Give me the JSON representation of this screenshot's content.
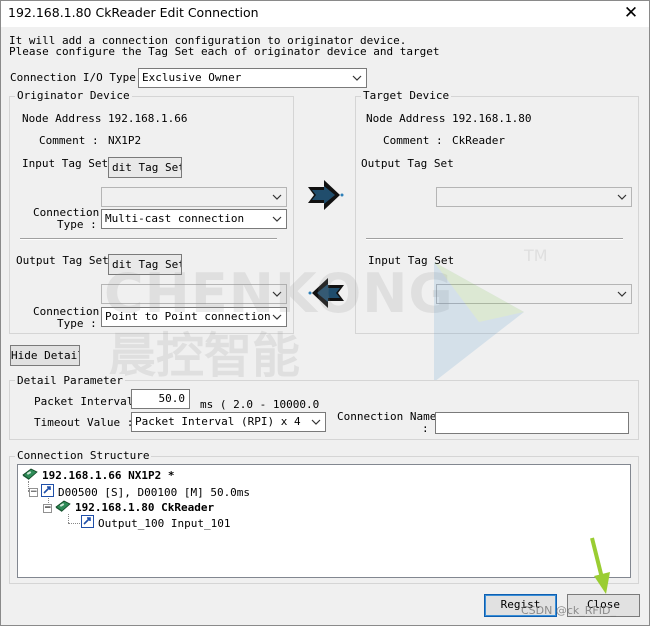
{
  "window": {
    "title": "192.168.1.80 CkReader Edit Connection"
  },
  "info": {
    "line1": "It will add a connection configuration to originator device.",
    "line2": "Please configure the Tag Set each of originator device and target"
  },
  "connection_io": {
    "label": "Connection I/O Type",
    "value": "Exclusive Owner"
  },
  "originator": {
    "group_label": "Originator Device",
    "node_address_label": "Node Address",
    "node_address": "192.168.1.66",
    "comment_label": "Comment :",
    "comment": "NX1P2",
    "input_tag_set_label": "Input Tag Set",
    "edit_tag_sets_1": "dit Tag Set:",
    "input_tag_value": "",
    "conn_type_label_1": "Connection",
    "conn_type_label_2": "Type :",
    "input_conn_type": "Multi-cast connection",
    "output_tag_set_label": "Output Tag Set",
    "edit_tag_sets_2": "dit Tag Set:",
    "output_tag_value": "",
    "output_conn_type": "Point to Point connection"
  },
  "target": {
    "group_label": "Target Device",
    "node_address_label": "Node Address",
    "node_address": "192.168.1.80",
    "comment_label": "Comment :",
    "comment": "CkReader",
    "output_tag_set_label": "Output Tag Set",
    "output_tag_value": "",
    "input_tag_set_label": "Input Tag Set",
    "input_tag_value": ""
  },
  "hide_detail": "Hide Detail",
  "detail": {
    "group_label": "Detail Parameter",
    "packet_interval_label": "Packet Interval",
    "packet_interval": "50.0",
    "packet_range": "ms ( 2.0 - 10000.0",
    "timeout_label": "Timeout Value :",
    "timeout_value": "Packet Interval (RPI) x 4",
    "connection_name_label_1": "Connection Name",
    "connection_name_label_2": ":",
    "connection_name": ""
  },
  "structure": {
    "group_label": "Connection Structure",
    "row1": "192.168.1.66 NX1P2 *",
    "row2": "D00500 [S], D00100 [M] 50.0ms",
    "row3": "192.168.1.80 CkReader",
    "row4": "Output_100 Input_101"
  },
  "buttons": {
    "regist": "Regist",
    "close": "Close"
  },
  "watermark": {
    "brand_en": "CHENKONG",
    "brand_cn": "晨控智能",
    "tm": "TM",
    "csdn": "CSDN @ck_RFID_"
  },
  "colors": {
    "accent_arrow": "#9ACD32",
    "tree_icon_blue": "#1f4fa8",
    "tree_icon_green": "#2e8b57"
  }
}
